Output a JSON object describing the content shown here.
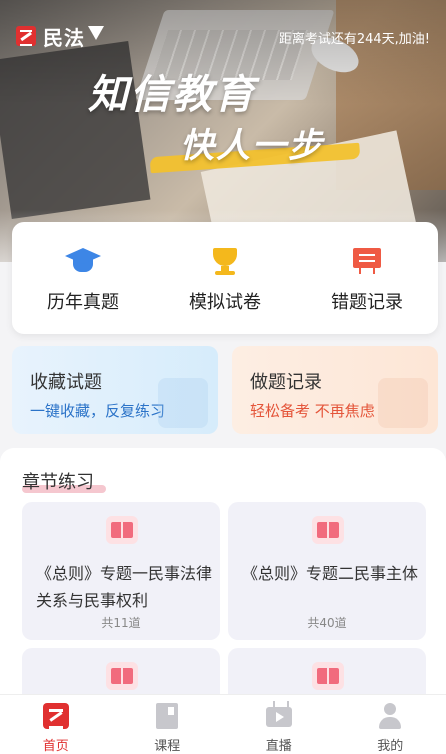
{
  "header": {
    "subject": "民法",
    "countdown": "距离考试还有244天,加油!",
    "slogan_line1": "知信教育",
    "slogan_line2": "快人一步"
  },
  "quick_actions": [
    {
      "label": "历年真题",
      "icon": "graduation-cap-icon"
    },
    {
      "label": "模拟试卷",
      "icon": "trophy-icon"
    },
    {
      "label": "错题记录",
      "icon": "whiteboard-icon"
    }
  ],
  "features": [
    {
      "title": "收藏试题",
      "subtitle": "一键收藏，反复练习"
    },
    {
      "title": "做题记录",
      "subtitle": "轻松备考 不再焦虑"
    }
  ],
  "chapter": {
    "heading": "章节练习",
    "cards": [
      {
        "title": "《总则》专题一民事法律关系与民事权利",
        "count": "共11道"
      },
      {
        "title": "《总则》专题二民事主体",
        "count": "共40道"
      },
      {
        "title": "",
        "count": ""
      },
      {
        "title": "",
        "count": ""
      }
    ]
  },
  "tabbar": [
    {
      "label": "首页",
      "active": true
    },
    {
      "label": "课程"
    },
    {
      "label": "直播"
    },
    {
      "label": "我的"
    }
  ],
  "colors": {
    "brand_red": "#e03030",
    "blue_accent": "#2b73c8",
    "orange_accent": "#e4553a",
    "highlight_yellow": "#f2c12e"
  }
}
